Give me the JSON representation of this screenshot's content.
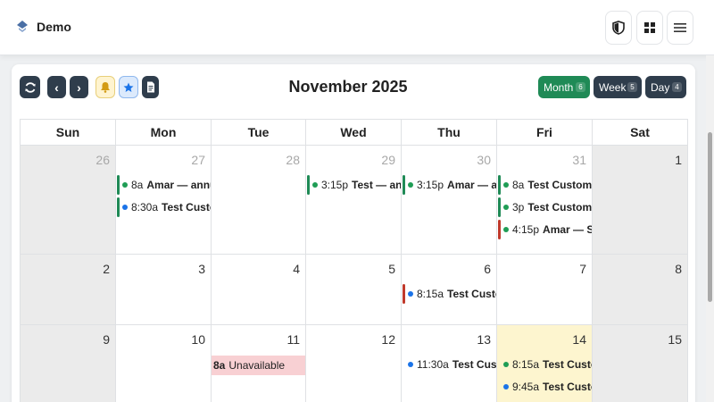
{
  "app": {
    "title": "Demo"
  },
  "header_icons": [
    "shield-icon",
    "grid-icon",
    "menu-icon"
  ],
  "toolbar": {
    "refresh_icon": "refresh-icon",
    "prev_label": "‹",
    "next_label": "›",
    "bell_icon": "bell-icon",
    "star_icon": "star-icon",
    "doc_icon": "document-icon"
  },
  "calendar": {
    "title": "November 2025",
    "views": [
      {
        "label": "Month",
        "count": "6",
        "active": true
      },
      {
        "label": "Week",
        "count": "5",
        "active": false
      },
      {
        "label": "Day",
        "count": "4",
        "active": false
      }
    ],
    "weekdays": [
      "Sun",
      "Mon",
      "Tue",
      "Wed",
      "Thu",
      "Fri",
      "Sat"
    ],
    "weeks": [
      {
        "days": [
          {
            "num": "26",
            "muted": true,
            "weekend": true,
            "events": []
          },
          {
            "num": "27",
            "muted": true,
            "events": [
              {
                "time": "8a",
                "title": "Amar — annual",
                "dot": "#1f9d55",
                "bar": "#1f8a56"
              },
              {
                "time": "8:30a",
                "title": "Test Customer",
                "dot": "#1a73e8",
                "bar": "#1f8a56"
              }
            ]
          },
          {
            "num": "28",
            "muted": true,
            "events": []
          },
          {
            "num": "29",
            "muted": true,
            "events": [
              {
                "time": "3:15p",
                "title": "Test — annual",
                "dot": "#1f9d55",
                "bar": "#1f8a56"
              }
            ]
          },
          {
            "num": "30",
            "muted": true,
            "events": [
              {
                "time": "3:15p",
                "title": "Amar — annual",
                "dot": "#1f9d55",
                "bar": "#1f8a56"
              }
            ]
          },
          {
            "num": "31",
            "muted": true,
            "events": [
              {
                "time": "8a",
                "title": "Test Customer —",
                "dot": "#1f9d55",
                "bar": "#1f8a56"
              },
              {
                "time": "3p",
                "title": "Test Customer —",
                "dot": "#1f9d55",
                "bar": "#1f8a56"
              },
              {
                "time": "4:15p",
                "title": "Amar — Summer",
                "dot": "#1f9d55",
                "bar": "#c0392b"
              }
            ]
          },
          {
            "num": "1",
            "muted": false,
            "weekend": true,
            "events": []
          }
        ]
      },
      {
        "days": [
          {
            "num": "2",
            "weekend": true,
            "events": []
          },
          {
            "num": "3",
            "events": []
          },
          {
            "num": "4",
            "events": []
          },
          {
            "num": "5",
            "events": []
          },
          {
            "num": "6",
            "events": [
              {
                "time": "8:15a",
                "title": "Test Customer",
                "dot": "#1a73e8",
                "bar": "#c0392b"
              }
            ]
          },
          {
            "num": "7",
            "events": []
          },
          {
            "num": "8",
            "weekend": true,
            "events": []
          }
        ]
      },
      {
        "days": [
          {
            "num": "9",
            "weekend": true,
            "events": []
          },
          {
            "num": "10",
            "events": []
          },
          {
            "num": "11",
            "events": [
              {
                "time": "8a",
                "title": "Unavailable",
                "unavailable": true
              }
            ]
          },
          {
            "num": "12",
            "events": []
          },
          {
            "num": "13",
            "events": [
              {
                "time": "11:30a",
                "title": "Test Customer",
                "dot": "#1a73e8"
              }
            ]
          },
          {
            "num": "14",
            "today": true,
            "events": [
              {
                "time": "8:15a",
                "title": "Test Customer",
                "dot": "#1f9d55"
              },
              {
                "time": "9:45a",
                "title": "Test Customer",
                "dot": "#1a73e8"
              }
            ]
          },
          {
            "num": "15",
            "weekend": true,
            "events": []
          }
        ]
      }
    ]
  }
}
